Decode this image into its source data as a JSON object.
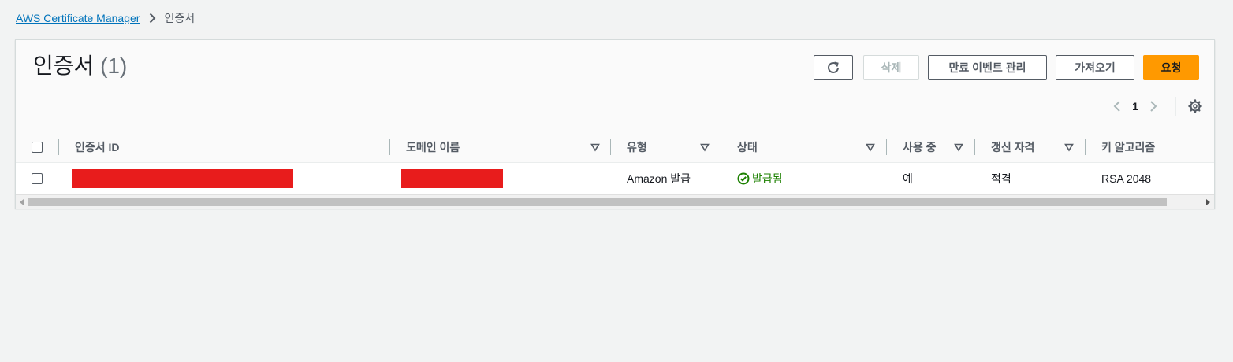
{
  "breadcrumb": {
    "service": "AWS Certificate Manager",
    "current": "인증서"
  },
  "panel": {
    "title": "인증서",
    "count": "(1)"
  },
  "toolbar": {
    "delete_label": "삭제",
    "expiry_events_label": "만료 이벤트 관리",
    "import_label": "가져오기",
    "request_label": "요청"
  },
  "pagination": {
    "current_page": "1"
  },
  "table": {
    "columns": {
      "cert_id": "인증서 ID",
      "domain": "도메인 이름",
      "type": "유형",
      "status": "상태",
      "in_use": "사용 중",
      "renewal": "갱신 자격",
      "key_algo": "키 알고리즘"
    },
    "rows": [
      {
        "type": "Amazon 발급",
        "status": "발급됨",
        "in_use": "예",
        "renewal": "적격",
        "key_algo": "RSA 2048"
      }
    ]
  },
  "colors": {
    "link": "#0073bb",
    "primary": "#ff9900",
    "success": "#1d8102",
    "redaction": "#e81c1c"
  },
  "icons": {
    "breadcrumb_separator": "chevron-right-icon",
    "refresh": "refresh-icon",
    "prev": "chevron-left-icon",
    "next": "chevron-right-icon",
    "settings": "gear-icon",
    "sort": "caret-down-icon",
    "status": "check-circle-icon"
  }
}
